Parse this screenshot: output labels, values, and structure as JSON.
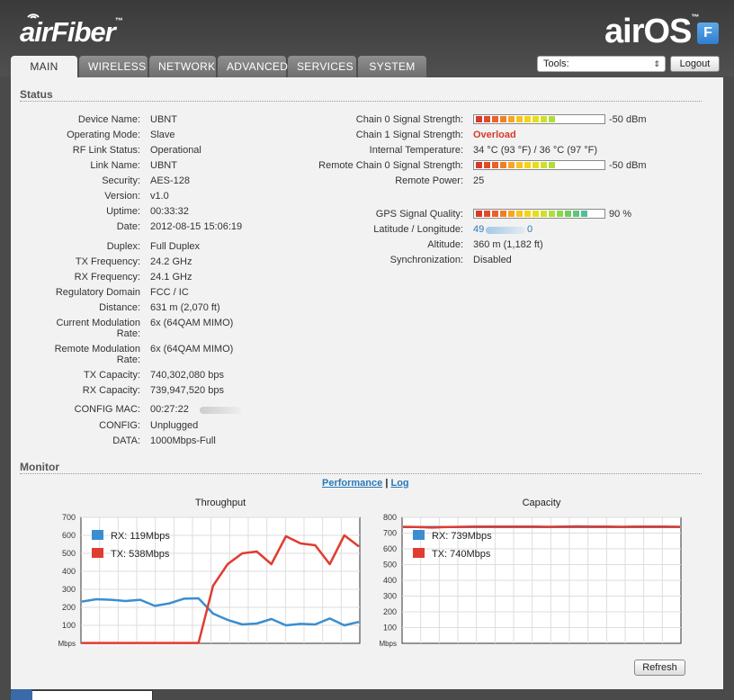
{
  "header": {
    "brand_left": "air",
    "brand_left2": "Fiber",
    "brand_left_tm": "™",
    "brand_right": "airOS",
    "brand_right_tm": "™",
    "badge": "F"
  },
  "tabs": [
    {
      "label": "MAIN",
      "active": true
    },
    {
      "label": "WIRELESS",
      "active": false
    },
    {
      "label": "NETWORK",
      "active": false
    },
    {
      "label": "ADVANCED",
      "active": false
    },
    {
      "label": "SERVICES",
      "active": false
    },
    {
      "label": "SYSTEM",
      "active": false
    }
  ],
  "toolbar": {
    "tools_label": "Tools:",
    "logout_label": "Logout"
  },
  "status": {
    "heading": "Status",
    "left": [
      {
        "label": "Device Name:",
        "value": "UBNT"
      },
      {
        "label": "Operating Mode:",
        "value": "Slave"
      },
      {
        "label": "RF Link Status:",
        "value": "Operational"
      },
      {
        "label": "Link Name:",
        "value": "UBNT"
      },
      {
        "label": "Security:",
        "value": "AES-128"
      },
      {
        "label": "Version:",
        "value": "v1.0"
      },
      {
        "label": "Uptime:",
        "value": "00:33:32"
      },
      {
        "label": "Date:",
        "value": "2012-08-15 15:06:19"
      },
      {
        "label": "Duplex:",
        "value": "Full Duplex"
      },
      {
        "label": "TX Frequency:",
        "value": "24.2 GHz"
      },
      {
        "label": "RX Frequency:",
        "value": "24.1 GHz"
      },
      {
        "label": "Regulatory Domain",
        "value": "FCC / IC"
      },
      {
        "label": "Distance:",
        "value": "631 m (2,070 ft)"
      },
      {
        "label": "Current Modulation",
        "label2": "Rate:",
        "value": "6x (64QAM MIMO)"
      },
      {
        "label": "Remote Modulation",
        "label2": "Rate:",
        "value": "6x (64QAM MIMO)"
      },
      {
        "label": "TX Capacity:",
        "value": "740,302,080 bps"
      },
      {
        "label": "RX Capacity:",
        "value": "739,947,520 bps"
      },
      {
        "label": "CONFIG MAC:",
        "value": "00:27:22"
      },
      {
        "label": "CONFIG:",
        "value": "Unplugged"
      },
      {
        "label": "DATA:",
        "value": "1000Mbps-Full"
      }
    ],
    "right": {
      "chain0_label": "Chain 0 Signal Strength:",
      "chain0_value": "-50 dBm",
      "chain0_level": 0.65,
      "chain1_label": "Chain 1 Signal Strength:",
      "chain1_value": "Overload",
      "temp_label": "Internal Temperature:",
      "temp_value": "34 °C (93 °F) / 36 °C (97 °F)",
      "remote0_label": "Remote Chain 0 Signal Strength:",
      "remote0_value": "-50 dBm",
      "remote0_level": 0.65,
      "remote_power_label": "Remote Power:",
      "remote_power_value": "25",
      "gps_label": "GPS Signal Quality:",
      "gps_value": "90 %",
      "gps_level": 0.9,
      "latlon_label": "Latitude / Longitude:",
      "latlon_value_a": "49",
      "latlon_value_b": "0",
      "altitude_label": "Altitude:",
      "altitude_value": "360 m (1,182 ft)",
      "sync_label": "Synchronization:",
      "sync_value": "Disabled"
    }
  },
  "monitor": {
    "heading": "Monitor",
    "link_performance": "Performance",
    "separator": "|",
    "link_log": "Log",
    "refresh_label": "Refresh"
  },
  "chart_data": [
    {
      "type": "line",
      "title": "Throughput",
      "ylabel": "Mbps",
      "ylim": [
        0,
        700
      ],
      "yticks": [
        100,
        200,
        300,
        400,
        500,
        600,
        700
      ],
      "series": [
        {
          "name": "RX: 119Mbps",
          "color": "#3a8ed0",
          "values": [
            232,
            245,
            242,
            235,
            242,
            208,
            222,
            248,
            250,
            165,
            130,
            105,
            110,
            135,
            100,
            108,
            105,
            138,
            100,
            119
          ]
        },
        {
          "name": "TX: 538Mbps",
          "color": "#e03c30",
          "values": [
            2,
            2,
            2,
            2,
            2,
            2,
            2,
            2,
            2,
            320,
            440,
            500,
            510,
            440,
            595,
            555,
            545,
            440,
            600,
            538
          ]
        }
      ]
    },
    {
      "type": "line",
      "title": "Capacity",
      "ylabel": "Mbps",
      "ylim": [
        0,
        800
      ],
      "yticks": [
        100,
        200,
        300,
        400,
        500,
        600,
        700,
        800
      ],
      "series": [
        {
          "name": "RX: 739Mbps",
          "color": "#3a8ed0",
          "values": [
            738,
            738,
            738,
            739,
            739,
            739,
            739,
            739,
            739,
            739,
            739,
            739,
            739,
            739,
            739,
            739,
            739,
            739,
            739,
            739
          ]
        },
        {
          "name": "TX: 740Mbps",
          "color": "#e03c30",
          "values": [
            740,
            738,
            735,
            738,
            740,
            741,
            741,
            742,
            742,
            742,
            740,
            742,
            743,
            741,
            741,
            740,
            741,
            742,
            741,
            740
          ]
        }
      ]
    }
  ]
}
